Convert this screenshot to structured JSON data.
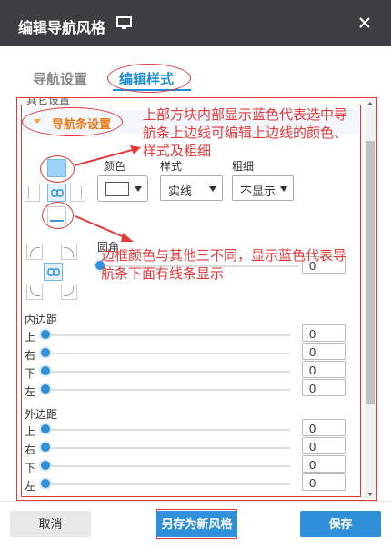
{
  "dialog": {
    "title": "编辑导航风格",
    "monitor_icon": "monitor-icon",
    "close_icon": "close-icon"
  },
  "tabs": [
    {
      "label": "导航设置",
      "active": false
    },
    {
      "label": "编辑样式",
      "active": true
    }
  ],
  "collapsed_section": {
    "label": "其它设置"
  },
  "section": {
    "label": "导航条设置",
    "annotation_top": "上部方块内部显示蓝色代表选中导航条上边线可编辑上边线的颜色、样式及粗细",
    "annotation_bottom": "边框颜色与其他三不同，显示蓝色代表导航条下面有线条显示",
    "border": {
      "color_label": "颜色",
      "style_label": "样式",
      "width_label": "粗细",
      "color_value": "#ffffff",
      "style_value": "实线",
      "width_value": "不显示"
    },
    "radius": {
      "label": "圆角",
      "value": "0",
      "level": 0
    },
    "padding": {
      "title": "内边距",
      "rows": [
        {
          "label": "上",
          "value": "0",
          "level": 0
        },
        {
          "label": "右",
          "value": "0",
          "level": 0
        },
        {
          "label": "下",
          "value": "0",
          "level": 0
        },
        {
          "label": "左",
          "value": "0",
          "level": 0
        }
      ]
    },
    "margin": {
      "title": "外边距",
      "rows": [
        {
          "label": "上",
          "value": "0",
          "level": 0
        },
        {
          "label": "右",
          "value": "0",
          "level": 0
        },
        {
          "label": "下",
          "value": "0",
          "level": 0
        },
        {
          "label": "左",
          "value": "0",
          "level": 0
        }
      ]
    }
  },
  "footer": {
    "cancel": "取消",
    "save_as": "另存为新风格",
    "save": "保存"
  },
  "colors": {
    "titlebar_bg": "#3b3f44",
    "accent": "#2f8fd8",
    "annotation": "#e23a3a",
    "section_title": "#e67c1c"
  }
}
